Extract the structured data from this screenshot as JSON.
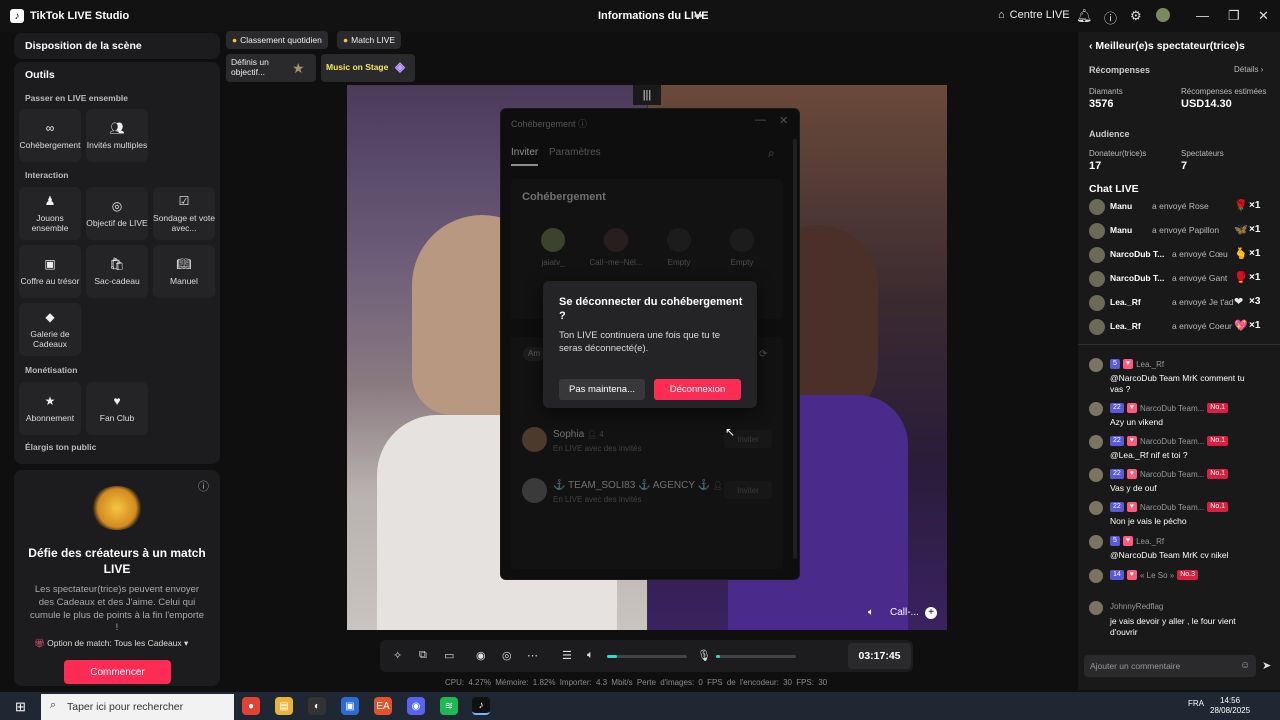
{
  "app": {
    "title": "TikTok LIVE Studio",
    "center_title": "Informations du LIVE",
    "centre_live": "Centre LIVE"
  },
  "left": {
    "scene_title": "Disposition de la scène",
    "tools_title": "Outils",
    "sections": {
      "together": "Passer en LIVE ensemble",
      "interaction": "Interaction",
      "monetization": "Monétisation",
      "audience": "Élargis ton public"
    },
    "tools": {
      "cohost": "Cohébergement",
      "multi": "Invités multiples",
      "play": "Jouons ensemble",
      "goal": "Objectif de LIVE",
      "poll": "Sondage et vote avec...",
      "chest": "Coffre au trésor",
      "giftbag": "Sac-cadeau",
      "manual": "Manuel",
      "gallery": "Galerie de Cadeaux",
      "subscription": "Abonnement",
      "fanclub": "Fan Club"
    },
    "promo": {
      "title": "Défie des créateurs à un match LIVE",
      "desc": "Les spectateur(trice)s peuvent envoyer des Cadeaux et des J'aime. Celui qui cumule le plus de points à la fin l'emporte !",
      "option": "Option de match: Tous les Cadeaux",
      "start": "Commencer"
    }
  },
  "chips": {
    "ranking": "Classement quotidien",
    "match": "Match LIVE",
    "goal": "Définis un objectif...",
    "stage": "Music on Stage"
  },
  "video": {
    "cam_name": "Call-..."
  },
  "cohost_dialog": {
    "title": "Cohébergement",
    "tab_invite": "Inviter",
    "tab_settings": "Paramètres",
    "section": "Cohébergement",
    "slots": [
      "jaiatv_",
      "Call~me~Nél...",
      "Empty",
      "Empty"
    ],
    "filter": "Am",
    "guests": [
      {
        "name": "Sophia",
        "count": "4",
        "sub": "En LIVE avec des invités",
        "btn": "Inviter"
      },
      {
        "name": "⚓ TEAM_SOLI83 ⚓ AGENCY ⚓",
        "count": "2",
        "sub": "En LIVE avec des invités",
        "btn": "Inviter"
      }
    ]
  },
  "confirm": {
    "title": "Se déconnecter du cohébergement ?",
    "desc": "Ton LIVE continuera une fois que tu te seras déconnecté(e).",
    "later": "Pas maintena...",
    "disconnect": "Déconnexion"
  },
  "controls": {
    "timer": "03:17:45",
    "mic_level": 0.05,
    "volume_level": 0.12
  },
  "stats": {
    "text": "CPU: 4.27%   Mémoire: 1.82%   Importer: 4.3 Mbit/s   Perte d'images: 0   FPS de l'encodeur: 30   FPS: 30"
  },
  "right": {
    "title": "Meilleur(e)s spectateur(trice)s",
    "rewards": "Récompenses",
    "details": "Détails",
    "diamonds_label": "Diamants",
    "diamonds": "3576",
    "est_label": "Récompenses estimées",
    "est": "USD14.30",
    "audience": "Audience",
    "donors_label": "Donateur(trice)s",
    "donors": "17",
    "viewers_label": "Spectateurs",
    "viewers": "7",
    "chat_title": "Chat LIVE",
    "gifts": [
      {
        "name": "Manu",
        "text": "a envoyé Rose",
        "icon": "🌹",
        "count": "×1"
      },
      {
        "name": "Manu",
        "text": "a envoyé Papillon",
        "icon": "🦋",
        "count": "×1"
      },
      {
        "name": "NarcoDub T...",
        "text": "a envoyé Cœu",
        "icon": "🫰",
        "count": "×1"
      },
      {
        "name": "NarcoDub T...",
        "text": "a envoyé Gant",
        "icon": "🥊",
        "count": "×1"
      },
      {
        "name": "Lea._Rf",
        "text": "a envoyé Je t'ado",
        "icon": "❤",
        "count": "×3"
      },
      {
        "name": "Lea._Rf",
        "text": "a envoyé Coeur s",
        "icon": "💖",
        "count": "×1"
      }
    ],
    "messages": [
      {
        "lvl": "5",
        "user": "Lea._Rf",
        "text": "@NarcoDub Team MrK comment tu vas ?"
      },
      {
        "lvl": "22",
        "user": "NarcoDub Team...",
        "no": "No.1",
        "text": "Azy un vikend"
      },
      {
        "lvl": "22",
        "user": "NarcoDub Team...",
        "no": "No.1",
        "text": "@Lea._Rf nif et toi ?"
      },
      {
        "lvl": "22",
        "user": "NarcoDub Team...",
        "no": "No.1",
        "text": "Vas y de ouf"
      },
      {
        "lvl": "22",
        "user": "NarcoDub Team...",
        "no": "No.1",
        "text": "Non je vais le pécho"
      },
      {
        "lvl": "5",
        "user": "Lea._Rf",
        "text": "@NarcoDub Team MrK cv nikel"
      },
      {
        "lvl": "14",
        "user": "« Le So »",
        "no": "No.3",
        "text": ""
      },
      {
        "lvl": "",
        "user": "JohnnyRedflag",
        "text": "je vais devoir y aller , le four vient d'ouvrir"
      }
    ],
    "comment_placeholder": "Ajouter un commentaire"
  },
  "taskbar": {
    "search": "Taper ici pour rechercher",
    "lang": "FRA",
    "time": "14:56",
    "date": "28/08/2025"
  },
  "colors": {
    "accent": "#fe2c55",
    "panel": "#1c1c1e",
    "background": "#0f0f10"
  }
}
